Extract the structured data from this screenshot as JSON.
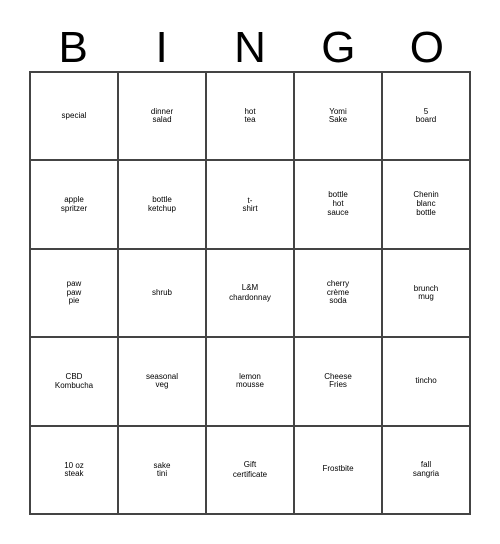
{
  "card": {
    "title_letters": [
      "B",
      "I",
      "N",
      "G",
      "O"
    ],
    "columns": 5,
    "rows": 5,
    "border_color": "#444444",
    "text_color": "#000000",
    "background_color": "#ffffff",
    "cells": [
      [
        {
          "text": "special",
          "size": "m"
        },
        {
          "text": "dinner\nsalad",
          "size": "xl"
        },
        {
          "text": "hot\ntea",
          "size": "3xl"
        },
        {
          "text": "Yomi\nSake",
          "size": "3xl"
        },
        {
          "text": "5\nboard",
          "size": "xxl"
        }
      ],
      [
        {
          "text": "apple\nspritzer",
          "size": "l"
        },
        {
          "text": "bottle\nketchup",
          "size": "l"
        },
        {
          "text": "t-\nshirt",
          "size": "3xl"
        },
        {
          "text": "bottle\nhot\nsauce",
          "size": "m"
        },
        {
          "text": "Chenin\nblanc\nbottle",
          "size": "m"
        }
      ],
      [
        {
          "text": "paw\npaw\npie",
          "size": "m"
        },
        {
          "text": "shrub",
          "size": "3xl"
        },
        {
          "text": "L&M\nchardonnay",
          "size": "xs"
        },
        {
          "text": "cherry\ncrème\nsoda",
          "size": "m"
        },
        {
          "text": "brunch\nmug",
          "size": "xl"
        }
      ],
      [
        {
          "text": "CBD\nKombucha",
          "size": "s"
        },
        {
          "text": "seasonal\nveg",
          "size": "l"
        },
        {
          "text": "lemon\nmousse",
          "size": "xl"
        },
        {
          "text": "Cheese\nFries",
          "size": "xl"
        },
        {
          "text": "tincho",
          "size": "xxl"
        }
      ],
      [
        {
          "text": "10 oz\nsteak",
          "size": "xxl"
        },
        {
          "text": "sake\ntini",
          "size": "3xl"
        },
        {
          "text": "Gift\ncertificate",
          "size": "s"
        },
        {
          "text": "Frostbite",
          "size": "l"
        },
        {
          "text": "fall\nsangria",
          "size": "l"
        }
      ]
    ]
  }
}
